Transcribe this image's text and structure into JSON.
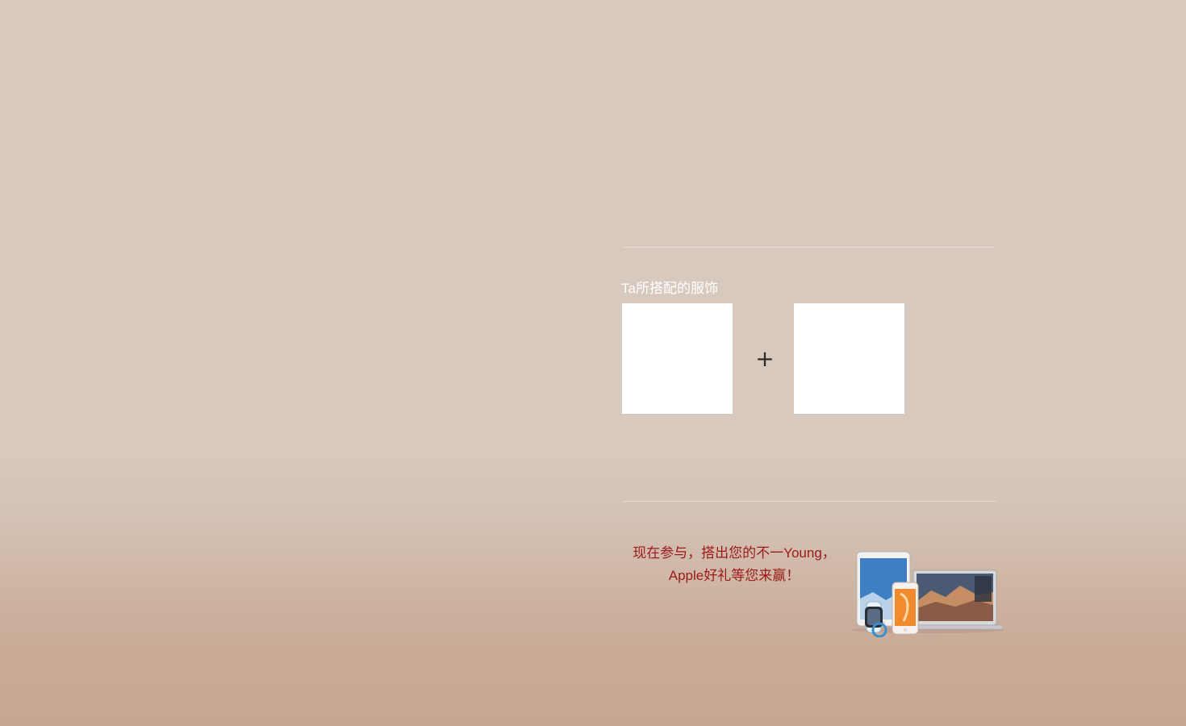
{
  "outfit_section": {
    "title": "Ta所搭配的服饰",
    "plus": "+"
  },
  "promo": {
    "line1": "现在参与，搭出您的不一Young，",
    "line2": "Apple好礼等您来赢！"
  },
  "colors": {
    "background_top": "#d7c9be",
    "background_bottom": "#c6a692",
    "promo_text": "#9c1a1a",
    "title_text": "#ffffff"
  },
  "icons": {
    "devices": "apple-devices-image"
  }
}
